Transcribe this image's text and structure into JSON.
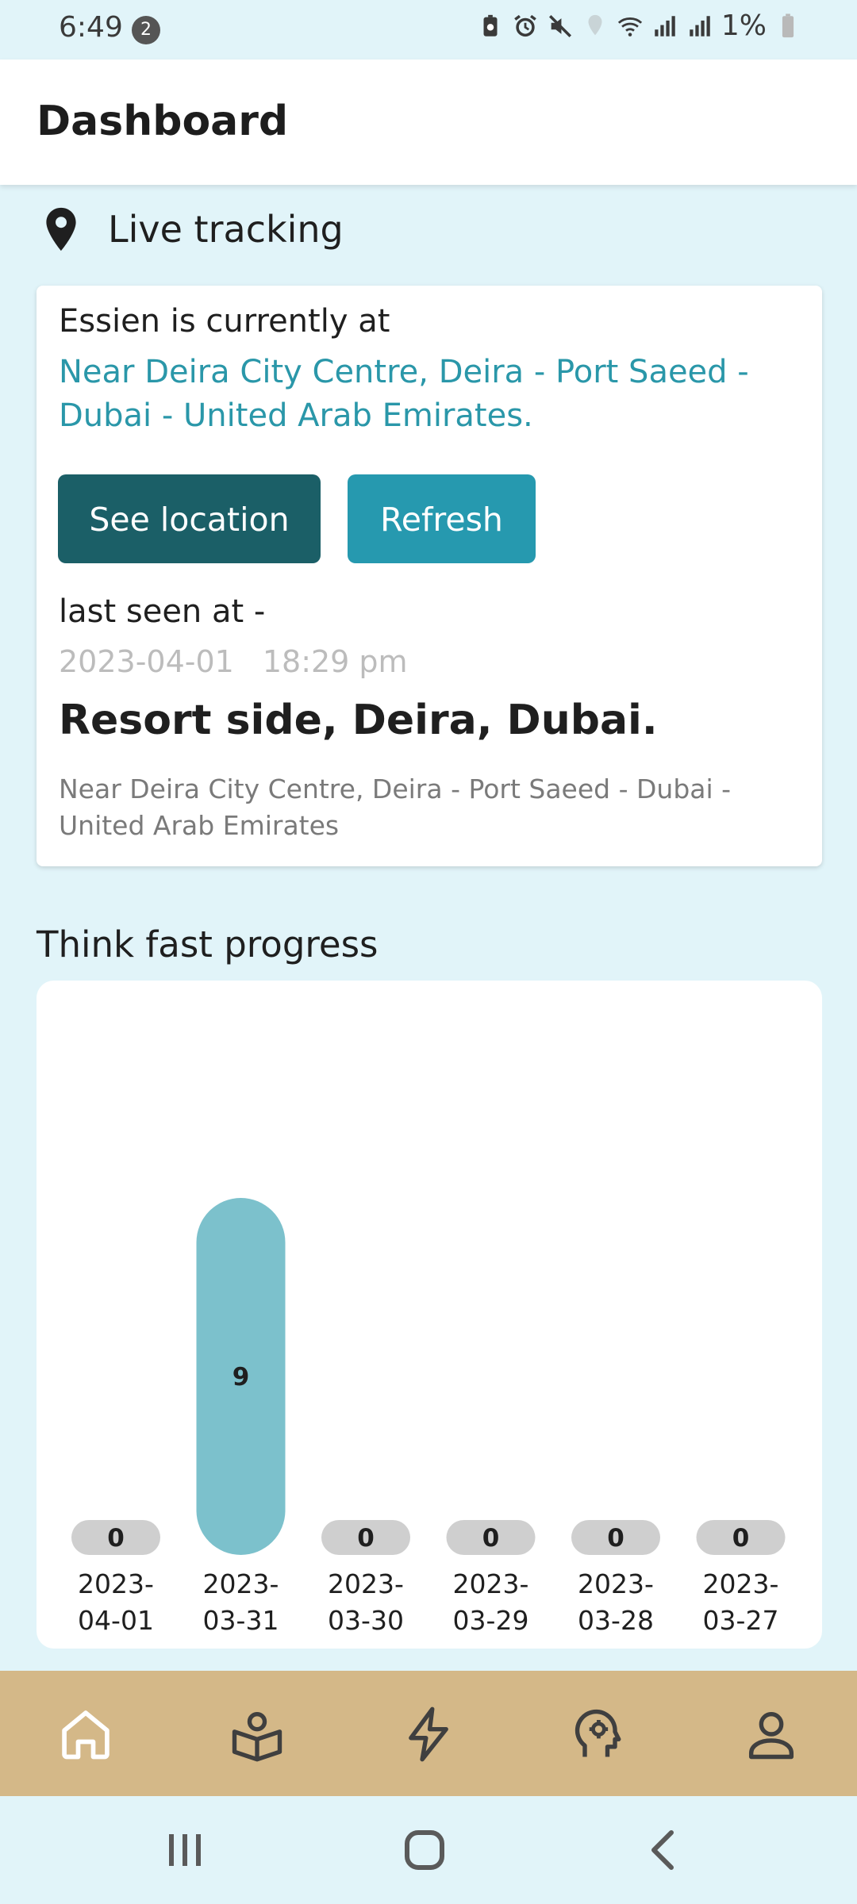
{
  "status_bar": {
    "time": "6:49",
    "notification_count": "2",
    "battery": "1%",
    "icons": [
      "battery-saver-icon",
      "alarm-icon",
      "mute-icon",
      "location-icon",
      "wifi-icon",
      "signal-icon",
      "signal-icon",
      "battery-icon"
    ]
  },
  "header": {
    "title": "Dashboard"
  },
  "live_tracking": {
    "section_title": "Live tracking",
    "icon": "location-pin-icon",
    "current_label": "Essien is currently at",
    "current_address": "Near Deira City Centre, Deira - Port Saeed - Dubai - United Arab Emirates.",
    "see_location_label": "See location",
    "refresh_label": "Refresh",
    "last_seen_label": "last seen at -",
    "last_seen_date": "2023-04-01",
    "last_seen_time": "18:29 pm",
    "place_name": "Resort side, Deira, Dubai.",
    "place_address": "Near Deira City Centre, Deira - Port Saeed - Dubai - United Arab Emirates"
  },
  "progress": {
    "section_title": "Think fast progress"
  },
  "chart_data": {
    "type": "bar",
    "title": "Think fast progress",
    "categories": [
      "2023-04-01",
      "2023-03-31",
      "2023-03-30",
      "2023-03-29",
      "2023-03-28",
      "2023-03-27"
    ],
    "values": [
      0,
      9,
      0,
      0,
      0,
      0
    ],
    "ylim": [
      0,
      10
    ],
    "grid": false,
    "legend": "none",
    "colors": {
      "bar": "#7cc1cc",
      "zero_bar": "#cfcfcf"
    }
  },
  "bottom_nav": {
    "items": [
      {
        "name": "home",
        "icon": "home-icon",
        "color": "#ffffff"
      },
      {
        "name": "learn",
        "icon": "book-user-icon",
        "color": "#3f3f3f"
      },
      {
        "name": "think-fast",
        "icon": "lightning-icon",
        "color": "#3f3f3f"
      },
      {
        "name": "mind",
        "icon": "brain-gear-icon",
        "color": "#3f3f3f"
      },
      {
        "name": "profile",
        "icon": "profile-icon",
        "color": "#3f3f3f"
      }
    ]
  },
  "colors": {
    "background": "#e1f4f9",
    "accent_dark": "#1b5f67",
    "accent": "#2699af",
    "nav_bar": "#d4b888"
  }
}
